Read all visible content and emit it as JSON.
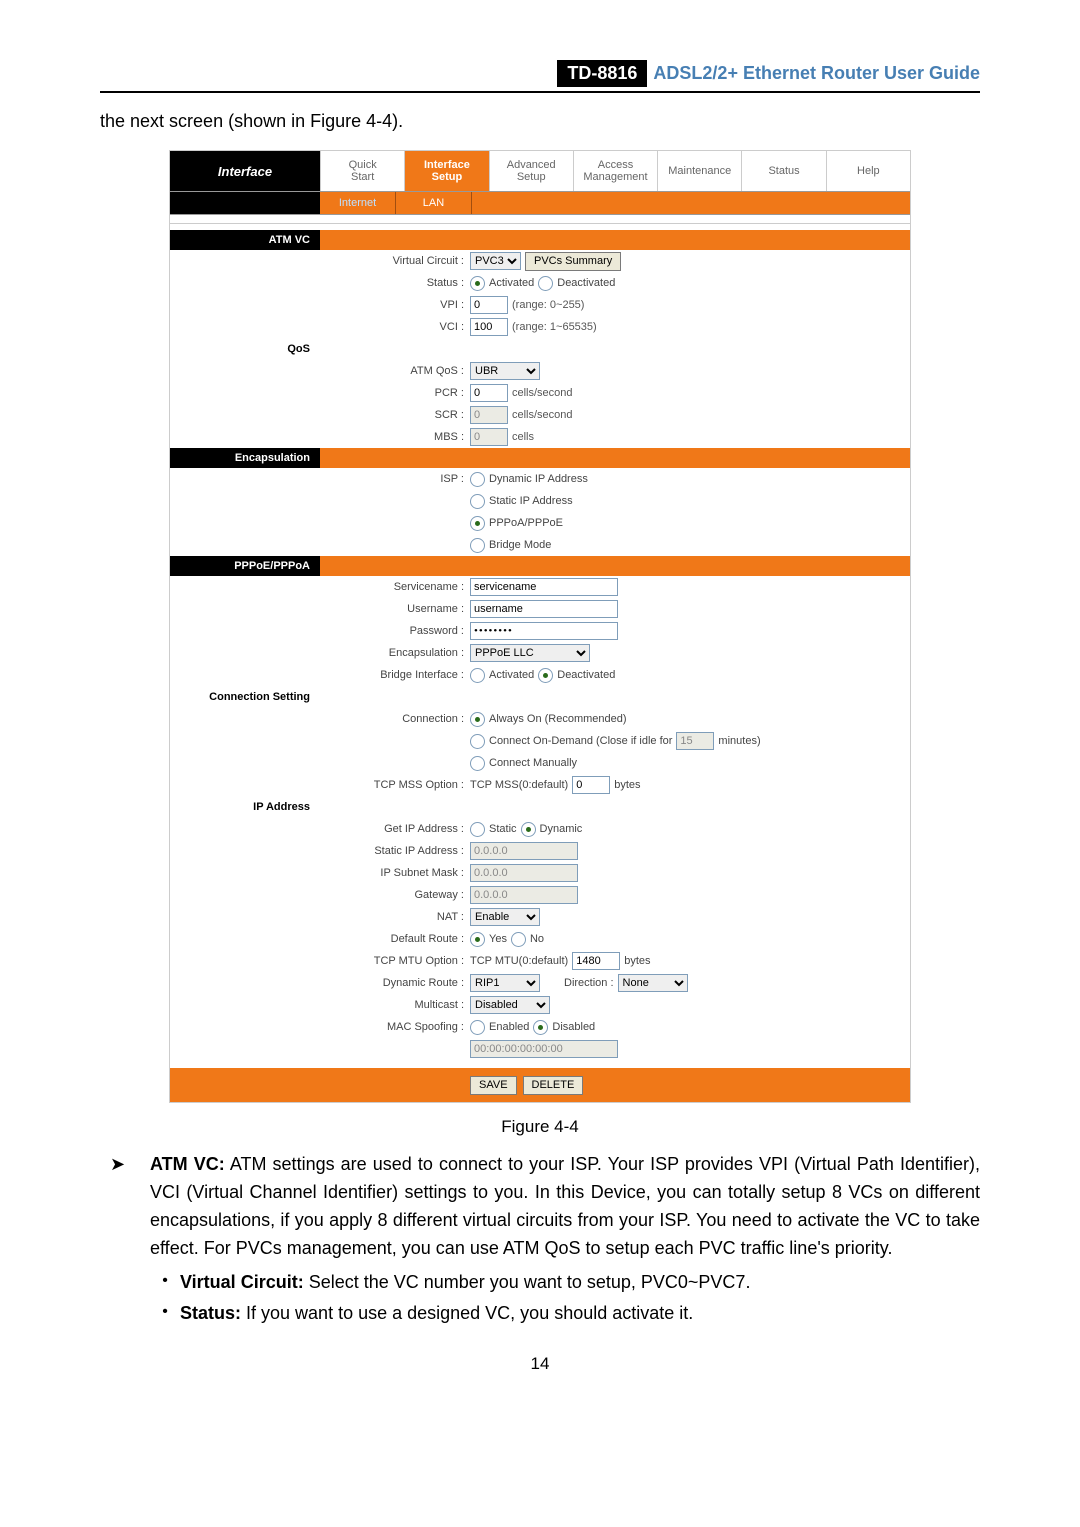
{
  "header": {
    "model": "TD-8816",
    "guide": "ADSL2/2+ Ethernet Router User Guide"
  },
  "intro": "the next screen (shown in Figure 4-4).",
  "nav": {
    "side": "Interface",
    "tabs": [
      "Quick\nStart",
      "Interface\nSetup",
      "Advanced\nSetup",
      "Access\nManagement",
      "Maintenance",
      "Status",
      "Help"
    ],
    "active": 1,
    "subtabs": [
      "Internet",
      "LAN"
    ],
    "sub_active": 0
  },
  "sections": {
    "atmvc": "ATM VC",
    "qos": "QoS",
    "encap": "Encapsulation",
    "ppp": "PPPoE/PPPoA",
    "conn": "Connection Setting",
    "ip": "IP Address"
  },
  "labels": {
    "vc": "Virtual Circuit :",
    "status": "Status :",
    "vpi": "VPI :",
    "vci": "VCI :",
    "atmqos": "ATM QoS :",
    "pcr": "PCR :",
    "scr": "SCR :",
    "mbs": "MBS :",
    "isp": "ISP :",
    "sname": "Servicename :",
    "uname": "Username :",
    "pwd": "Password :",
    "enc": "Encapsulation :",
    "bif": "Bridge Interface :",
    "connection": "Connection :",
    "tcpmss": "TCP MSS Option :",
    "getip": "Get IP Address :",
    "staticip": "Static IP Address :",
    "mask": "IP Subnet Mask :",
    "gw": "Gateway :",
    "nat": "NAT :",
    "droute": "Default Route :",
    "tcpmtu": "TCP MTU Option :",
    "dynroute": "Dynamic Route :",
    "direction": "Direction :",
    "multicast": "Multicast :",
    "macspoof": "MAC Spoofing :"
  },
  "values": {
    "vc_select": "PVC3",
    "pvcs_btn": "PVCs Summary",
    "status_opts": [
      "Activated",
      "Deactivated"
    ],
    "vpi": "0",
    "vpi_hint": "(range: 0~255)",
    "vci": "100",
    "vci_hint": "(range: 1~65535)",
    "atmqos_select": "UBR",
    "pcr": "0",
    "pcr_hint": "cells/second",
    "scr": "0",
    "scr_hint": "cells/second",
    "mbs": "0",
    "mbs_hint": "cells",
    "isp_opts": [
      "Dynamic IP Address",
      "Static IP Address",
      "PPPoA/PPPoE",
      "Bridge Mode"
    ],
    "sname": "servicename",
    "uname": "username",
    "pwd": "••••••••",
    "enc_select": "PPPoE LLC",
    "bif_opts": [
      "Activated",
      "Deactivated"
    ],
    "conn_opts": [
      "Always On (Recommended)",
      "Connect On-Demand (Close if idle for",
      "Connect Manually"
    ],
    "idle": "15",
    "idle_unit": "minutes)",
    "mss_label": "TCP MSS(0:default)",
    "mss": "0",
    "mss_unit": "bytes",
    "getip_opts": [
      "Static",
      "Dynamic"
    ],
    "sip": "0.0.0.0",
    "mask": "0.0.0.0",
    "gw": "0.0.0.0",
    "nat_select": "Enable",
    "droute_opts": [
      "Yes",
      "No"
    ],
    "mtu_label": "TCP MTU(0:default)",
    "mtu": "1480",
    "mtu_unit": "bytes",
    "dynroute_select": "RIP1",
    "direction_select": "None",
    "multicast_select": "Disabled",
    "macspoof_opts": [
      "Enabled",
      "Disabled"
    ],
    "mac": "00:00:00:00:00:00",
    "save": "SAVE",
    "delete": "DELETE"
  },
  "caption": "Figure 4-4",
  "body": {
    "p1_bold": "ATM VC:",
    "p1": " ATM settings are used to connect to your ISP. Your ISP provides VPI (Virtual Path Identifier), VCI (Virtual Channel Identifier) settings to you. In this Device, you can totally setup 8 VCs on different encapsulations, if you apply 8 different virtual circuits from your ISP. You need to activate the VC to take effect. For PVCs management, you can use ATM QoS to setup each PVC traffic line's priority.",
    "s1_bold": "Virtual Circuit:",
    "s1": " Select the VC number you want to setup, PVC0~PVC7.",
    "s2_bold": "Status:",
    "s2": " If you want to use a designed VC, you should activate it."
  },
  "page_num": "14"
}
